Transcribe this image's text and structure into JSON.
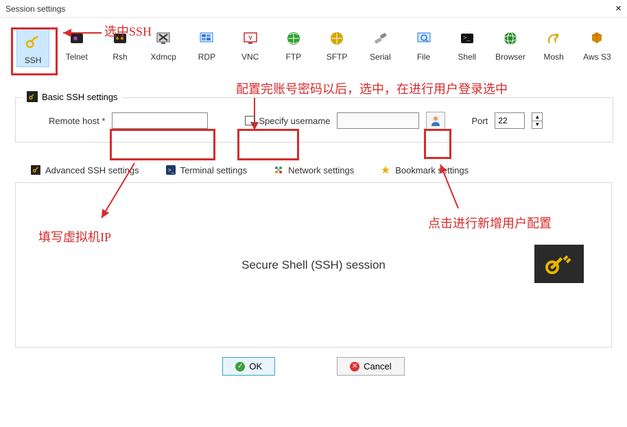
{
  "window": {
    "title": "Session settings"
  },
  "protocols": [
    {
      "name": "SSH",
      "icon": "key-icon",
      "color": "#d6a500"
    },
    {
      "name": "Telnet",
      "icon": "telnet-icon",
      "color": "#7a2ea0"
    },
    {
      "name": "Rsh",
      "icon": "rsh-icon",
      "color": "#d47a00"
    },
    {
      "name": "Xdmcp",
      "icon": "xdmcp-icon",
      "color": "#444"
    },
    {
      "name": "RDP",
      "icon": "rdp-icon",
      "color": "#2c7bd6"
    },
    {
      "name": "VNC",
      "icon": "vnc-icon",
      "color": "#c03030"
    },
    {
      "name": "FTP",
      "icon": "ftp-icon",
      "color": "#2ca02c"
    },
    {
      "name": "SFTP",
      "icon": "sftp-icon",
      "color": "#d6a500"
    },
    {
      "name": "Serial",
      "icon": "serial-icon",
      "color": "#888"
    },
    {
      "name": "File",
      "icon": "file-icon",
      "color": "#2c7bd6"
    },
    {
      "name": "Shell",
      "icon": "shell-icon",
      "color": "#222"
    },
    {
      "name": "Browser",
      "icon": "browser-icon",
      "color": "#2c8a2c"
    },
    {
      "name": "Mosh",
      "icon": "mosh-icon",
      "color": "#d6a500"
    },
    {
      "name": "Aws S3",
      "icon": "aws-icon",
      "color": "#d68a00"
    }
  ],
  "annotations": {
    "select_ssh": "选中SSH",
    "config_user_hint": "配置完账号密码以后，选中，在进行用户登录选中",
    "fill_ip": "填写虚拟机IP",
    "add_user": "点击进行新增用户配置"
  },
  "group": {
    "legend": "Basic SSH settings",
    "host_label": "Remote host *",
    "host_value": "",
    "specify_username_label": "Specify username",
    "username_value": "",
    "port_label": "Port",
    "port_value": "22"
  },
  "tabs": [
    {
      "label": "Advanced SSH settings",
      "icon": "key-icon"
    },
    {
      "label": "Terminal settings",
      "icon": "terminal-icon"
    },
    {
      "label": "Network settings",
      "icon": "network-icon"
    },
    {
      "label": "Bookmark settings",
      "icon": "star-icon"
    }
  ],
  "session_label": "Secure Shell (SSH) session",
  "buttons": {
    "ok": "OK",
    "cancel": "Cancel"
  }
}
